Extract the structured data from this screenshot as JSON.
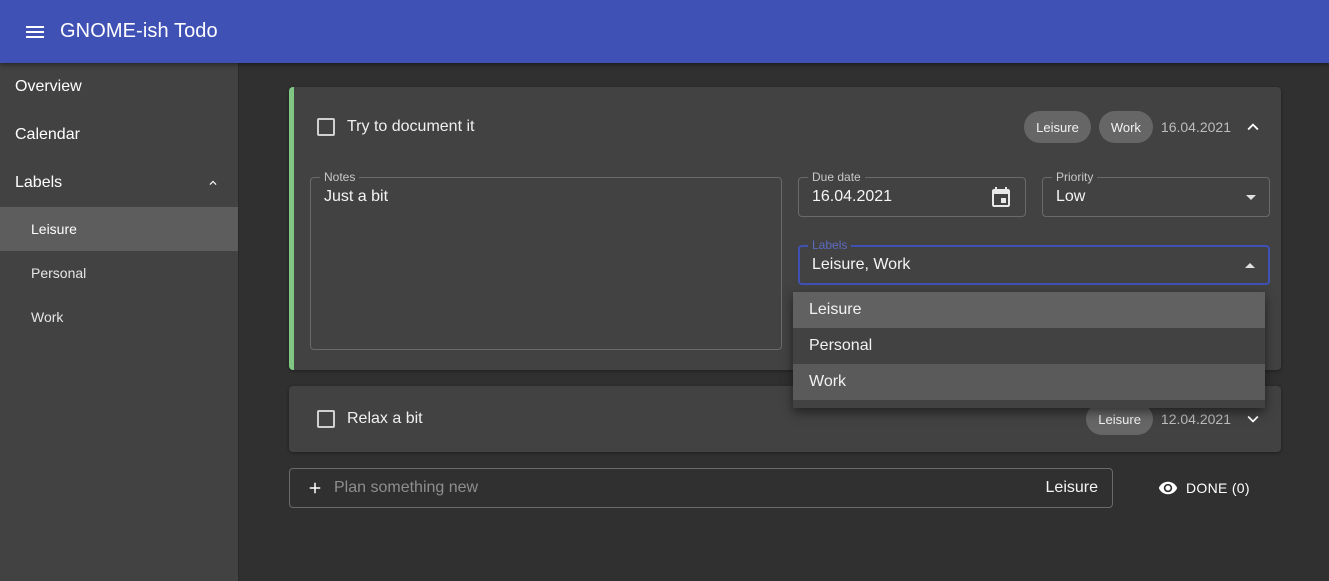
{
  "app": {
    "title": "GNOME-ish Todo"
  },
  "sidebar": {
    "items": [
      {
        "label": "Overview"
      },
      {
        "label": "Calendar"
      },
      {
        "label": "Labels"
      }
    ],
    "labels": [
      {
        "label": "Leisure",
        "active": true
      },
      {
        "label": "Personal",
        "active": false
      },
      {
        "label": "Work",
        "active": false
      }
    ]
  },
  "tasks": [
    {
      "title": "Try to document it",
      "chips": [
        "Leisure",
        "Work"
      ],
      "date": "16.04.2021",
      "expanded": true,
      "accent": "#81c784",
      "notes": {
        "label": "Notes",
        "value": "Just a bit"
      },
      "due": {
        "label": "Due date",
        "value": "16.04.2021"
      },
      "priority": {
        "label": "Priority",
        "value": "Low"
      },
      "labels": {
        "label": "Labels",
        "value": "Leisure, Work"
      }
    },
    {
      "title": "Relax a bit",
      "chips": [
        "Leisure"
      ],
      "date": "12.04.2021",
      "expanded": false
    }
  ],
  "dropdown": {
    "options": [
      "Leisure",
      "Personal",
      "Work"
    ]
  },
  "new_task": {
    "placeholder": "Plan something new",
    "label": "Leisure"
  },
  "done_button": {
    "label": "DONE (0)"
  },
  "colors": {
    "appbar": "#3f51b5",
    "background": "#303030",
    "surface": "#424242",
    "accent": "#81c784"
  }
}
